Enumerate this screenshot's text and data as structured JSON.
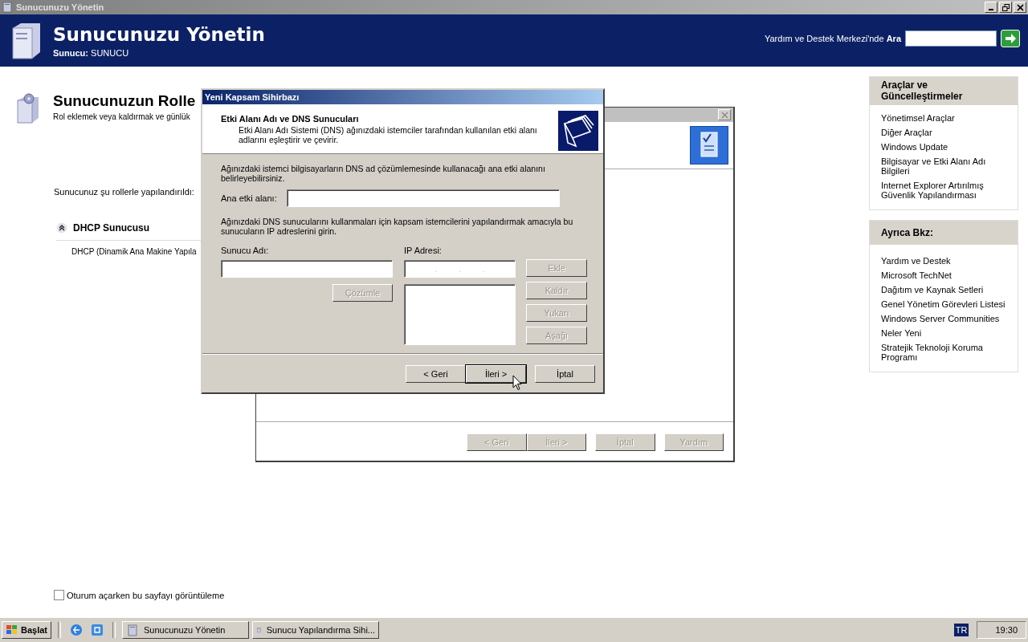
{
  "main_window": {
    "title": "Sunucunuzu Yönetin",
    "header_title": "Sunucunuzu Yönetin",
    "header_subtitle": "**Sunucu:** SUNUCU",
    "search_label": "Yardım ve Destek Merkezi'nde **Ara**"
  },
  "page": {
    "heading": "Sunucunuzun Rolle",
    "subheading": "Rol eklemek veya kaldırmak ve günlük",
    "roles_intro": "Sunucunuz şu rollerle yapılandırıldı:",
    "roles": [
      {
        "name": "DHCP Sunucusu",
        "expanded": true,
        "description": "DHCP (Dinamik Ana Makine Yapıla"
      }
    ]
  },
  "sidebar": [
    {
      "title": "Araçlar ve Güncelleştirmeler",
      "links": [
        "Yönetimsel Araçlar",
        "Diğer Araçlar",
        "Windows Update",
        "Bilgisayar ve Etki Alanı Adı Bilgileri",
        "Internet Explorer Artırılmış Güvenlik Yapılandırması"
      ]
    },
    {
      "title": "Ayrıca Bkz:",
      "links": [
        "Yardım ve Destek",
        "Microsoft TechNet",
        "Dağıtım ve Kaynak Setleri",
        "Genel Yönetim Görevleri Listesi",
        "Windows Server Communities",
        "Neler Yeni",
        "Stratejik Teknoloji Koruma Programı"
      ]
    }
  ],
  "startup_option": {
    "label": "Oturum açarken bu sayfayı görüntüleme",
    "checked": false
  },
  "background_wizard": {
    "buttons": [
      {
        "label": "< Geri",
        "disabled": true
      },
      {
        "label": "İleri >",
        "disabled": true
      },
      {
        "label": "İptal",
        "disabled": true
      },
      {
        "label": "Yardım",
        "disabled": true
      }
    ]
  },
  "dialog": {
    "title": "Yeni Kapsam Sihirbazı",
    "heading": "Etki Alanı Adı ve DNS Sunucuları",
    "description": "Etki Alanı Adı Sistemi (DNS) ağınızdaki istemciler tarafından kullanılan etki alanı adlarını eşleştirir ve çevirir.",
    "intro": "Ağınızdaki istemci bilgisayarların DNS ad çözümlemesinde kullanacağı ana etki alanını belirleyebilirsiniz.",
    "domain_label": "Ana etki alanı:",
    "servers_intro": "Ağınızdaki DNS sunucularını kullanmaları için kapsam istemcilerini yapılandırmak amacıyla bu sunucuların IP adreslerini girin.",
    "server_name_label": "Sunucu Adı:",
    "ip_label": "IP Adresi:",
    "ip_separators": [
      ".",
      ".",
      "."
    ],
    "resolve_button": {
      "label": "Çözümle",
      "disabled": true
    },
    "list_buttons": [
      {
        "label": "Ekle",
        "disabled": true
      },
      {
        "label": "Kaldır",
        "disabled": true
      },
      {
        "label": "Yukarı",
        "disabled": true
      },
      {
        "label": "Aşağı",
        "disabled": true
      }
    ],
    "nav_buttons": [
      {
        "label": "< Geri",
        "disabled": false,
        "default": false
      },
      {
        "label": "İleri >",
        "disabled": false,
        "default": true
      },
      {
        "label": "İptal",
        "disabled": false,
        "default": false
      }
    ]
  },
  "taskbar": {
    "start_label": "Başlat",
    "tasks": [
      {
        "label": "Sunucunuzu Yönetin",
        "selected": false
      },
      {
        "label": "Sunucu Yapılandırma Sihi...",
        "selected": false
      }
    ],
    "language": "TR",
    "clock": "19:30"
  }
}
